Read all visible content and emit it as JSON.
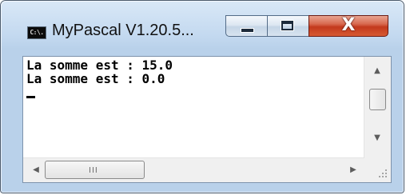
{
  "window": {
    "title": "MyPascal V1.20.5...",
    "icon": "console-app-icon",
    "icon_text": "C:\\."
  },
  "caption_buttons": {
    "minimize": "minimize-icon",
    "maximize": "maximize-icon",
    "close": "close-icon",
    "close_glyph": "X"
  },
  "console": {
    "lines": [
      "La somme est : 15.0",
      "La somme est : 0.0"
    ]
  },
  "scrollbars": {
    "up_arrow": "▲",
    "down_arrow": "▼",
    "left_arrow": "◀",
    "right_arrow": "▶",
    "h_thumb_grip": "III"
  },
  "colors": {
    "close_button": "#c3391d",
    "frame": "#b9d1ea",
    "console_text": "#000000"
  }
}
